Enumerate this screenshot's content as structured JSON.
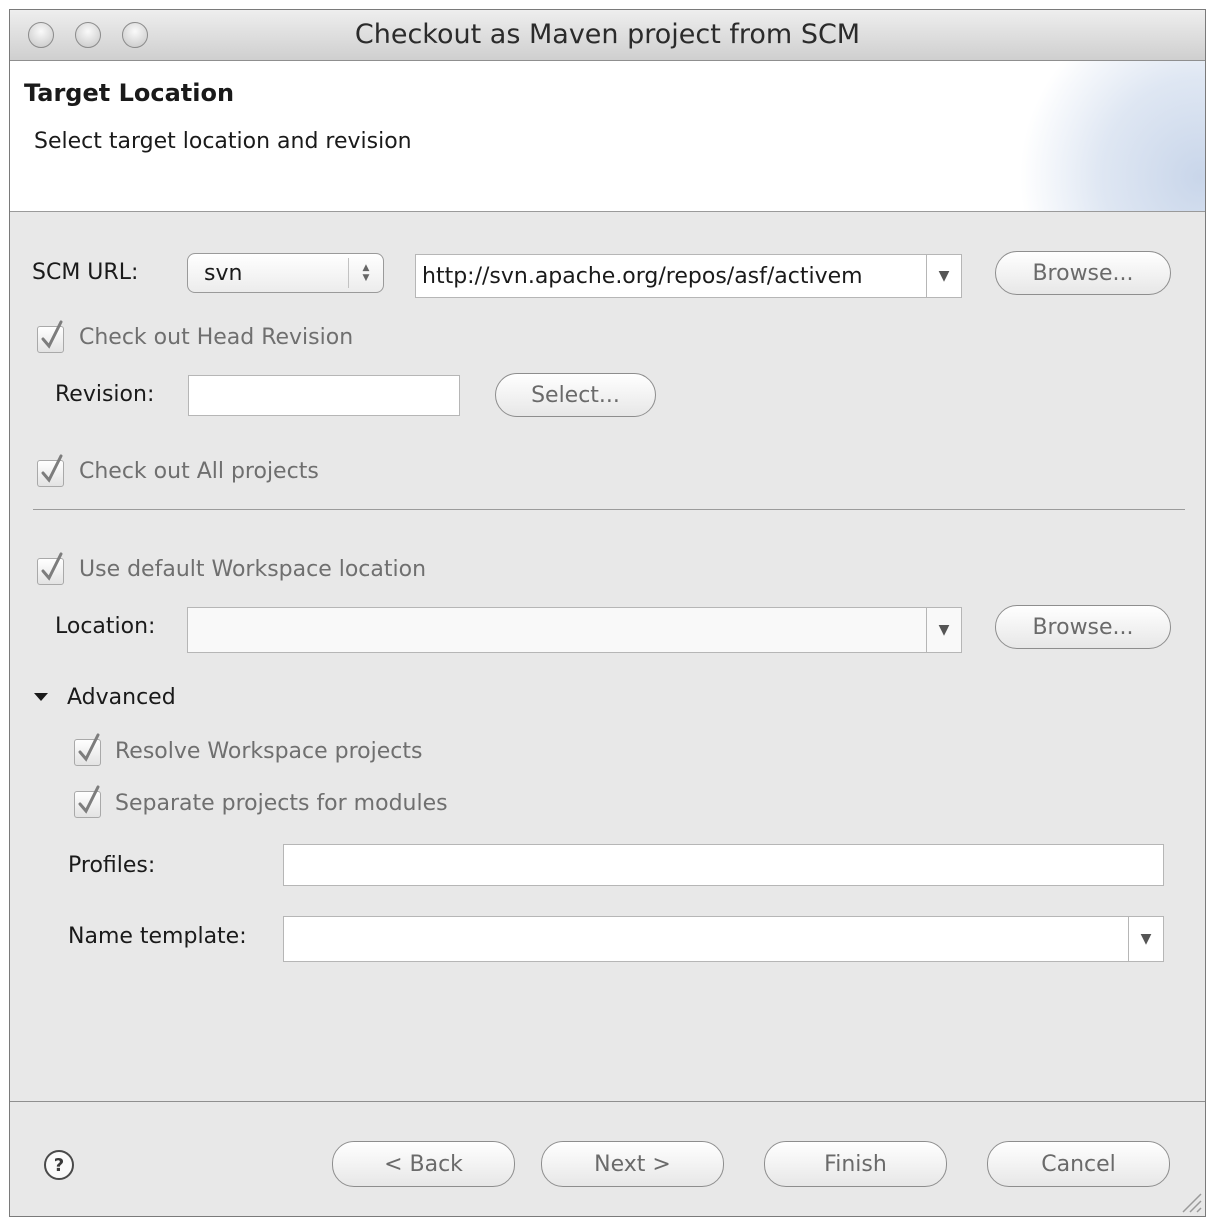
{
  "window": {
    "title": "Checkout as Maven project from SCM"
  },
  "banner": {
    "title": "Target Location",
    "description": "Select target location and revision"
  },
  "scm": {
    "label": "SCM URL:",
    "type_value": "svn",
    "url_value": "http://svn.apache.org/repos/asf/activem",
    "browse_label": "Browse..."
  },
  "revision": {
    "head_checkbox_label": "Check out Head Revision",
    "head_checked": true,
    "label": "Revision:",
    "value": "",
    "select_label": "Select..."
  },
  "all_projects": {
    "label": "Check out All projects",
    "checked": true
  },
  "workspace": {
    "default_label": "Use default Workspace location",
    "default_checked": true,
    "location_label": "Location:",
    "location_value": "",
    "browse_label": "Browse..."
  },
  "advanced": {
    "label": "Advanced",
    "expanded": true,
    "resolve_label": "Resolve Workspace projects",
    "resolve_checked": true,
    "separate_label": "Separate projects for modules",
    "separate_checked": true,
    "profiles_label": "Profiles:",
    "profiles_value": "",
    "name_template_label": "Name template:",
    "name_template_value": ""
  },
  "footer": {
    "help_icon": "help-icon",
    "back_label": "< Back",
    "next_label": "Next >",
    "finish_label": "Finish",
    "cancel_label": "Cancel"
  }
}
